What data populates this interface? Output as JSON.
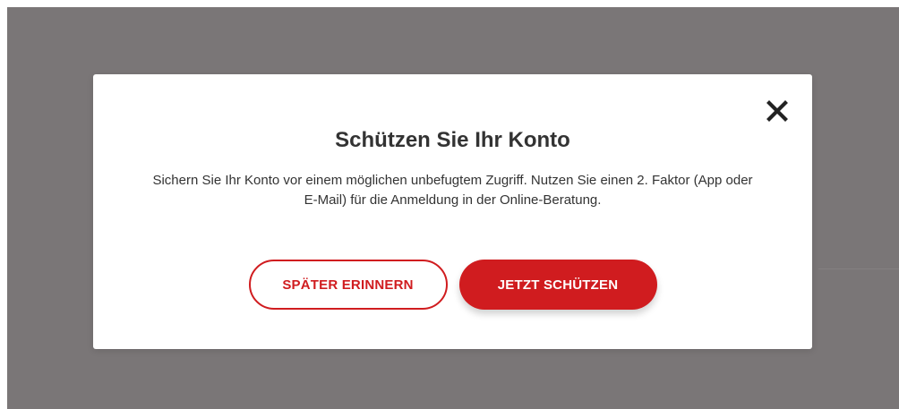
{
  "dialog": {
    "title": "Schützen Sie Ihr Konto",
    "message": "Sichern Sie Ihr Konto vor einem möglichen unbefugtem Zugriff. Nutzen Sie einen 2. Faktor (App oder E-Mail) für die Anmeldung in der Online-Beratung.",
    "close_icon": "close-icon",
    "buttons": {
      "later_label": "SPÄTER ERINNERN",
      "protect_label": "JETZT SCHÜTZEN"
    }
  },
  "colors": {
    "accent": "#d01c1f",
    "overlay": "#7a7677",
    "text": "#333333"
  }
}
